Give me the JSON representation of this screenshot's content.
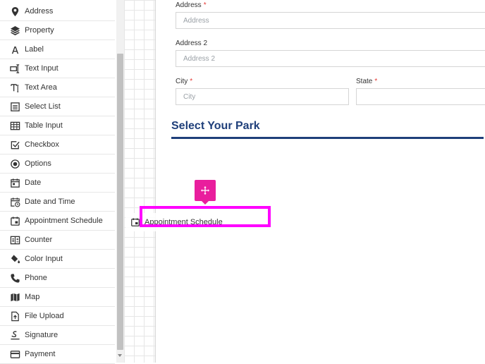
{
  "sidebar": {
    "items": [
      {
        "label": "Address",
        "icon": "map-pin-icon"
      },
      {
        "label": "Property",
        "icon": "layers-icon"
      },
      {
        "label": "Label",
        "icon": "letter-a-icon"
      },
      {
        "label": "Text Input",
        "icon": "text-input-icon"
      },
      {
        "label": "Text Area",
        "icon": "text-area-icon"
      },
      {
        "label": "Select List",
        "icon": "list-icon"
      },
      {
        "label": "Table Input",
        "icon": "table-icon"
      },
      {
        "label": "Checkbox",
        "icon": "checkbox-icon"
      },
      {
        "label": "Options",
        "icon": "radio-icon"
      },
      {
        "label": "Date",
        "icon": "calendar-icon"
      },
      {
        "label": "Date and Time",
        "icon": "calendar-clock-icon"
      },
      {
        "label": "Appointment Schedule",
        "icon": "schedule-icon"
      },
      {
        "label": "Counter",
        "icon": "counter-icon"
      },
      {
        "label": "Color Input",
        "icon": "paint-bucket-icon"
      },
      {
        "label": "Phone",
        "icon": "phone-icon"
      },
      {
        "label": "Map",
        "icon": "map-icon"
      },
      {
        "label": "File Upload",
        "icon": "file-upload-icon"
      },
      {
        "label": "Signature",
        "icon": "signature-icon"
      },
      {
        "label": "Payment",
        "icon": "credit-card-icon"
      }
    ]
  },
  "form": {
    "address": {
      "label": "Address",
      "required": "*",
      "placeholder": "Address"
    },
    "address2": {
      "label": "Address 2",
      "placeholder": "Address 2"
    },
    "city": {
      "label": "City",
      "required": "*",
      "placeholder": "City"
    },
    "state": {
      "label": "State",
      "required": "*",
      "placeholder": ""
    },
    "section_heading": "Select Your Park"
  },
  "drag": {
    "ghost_label": "Appointment Schedule",
    "ghost_icon": "schedule-icon",
    "handle_icon": "move-arrows-icon",
    "highlight_color": "#ff00ff",
    "handle_color": "#e91e9d"
  },
  "colors": {
    "heading": "#1f3f7a",
    "required": "#e53935"
  }
}
